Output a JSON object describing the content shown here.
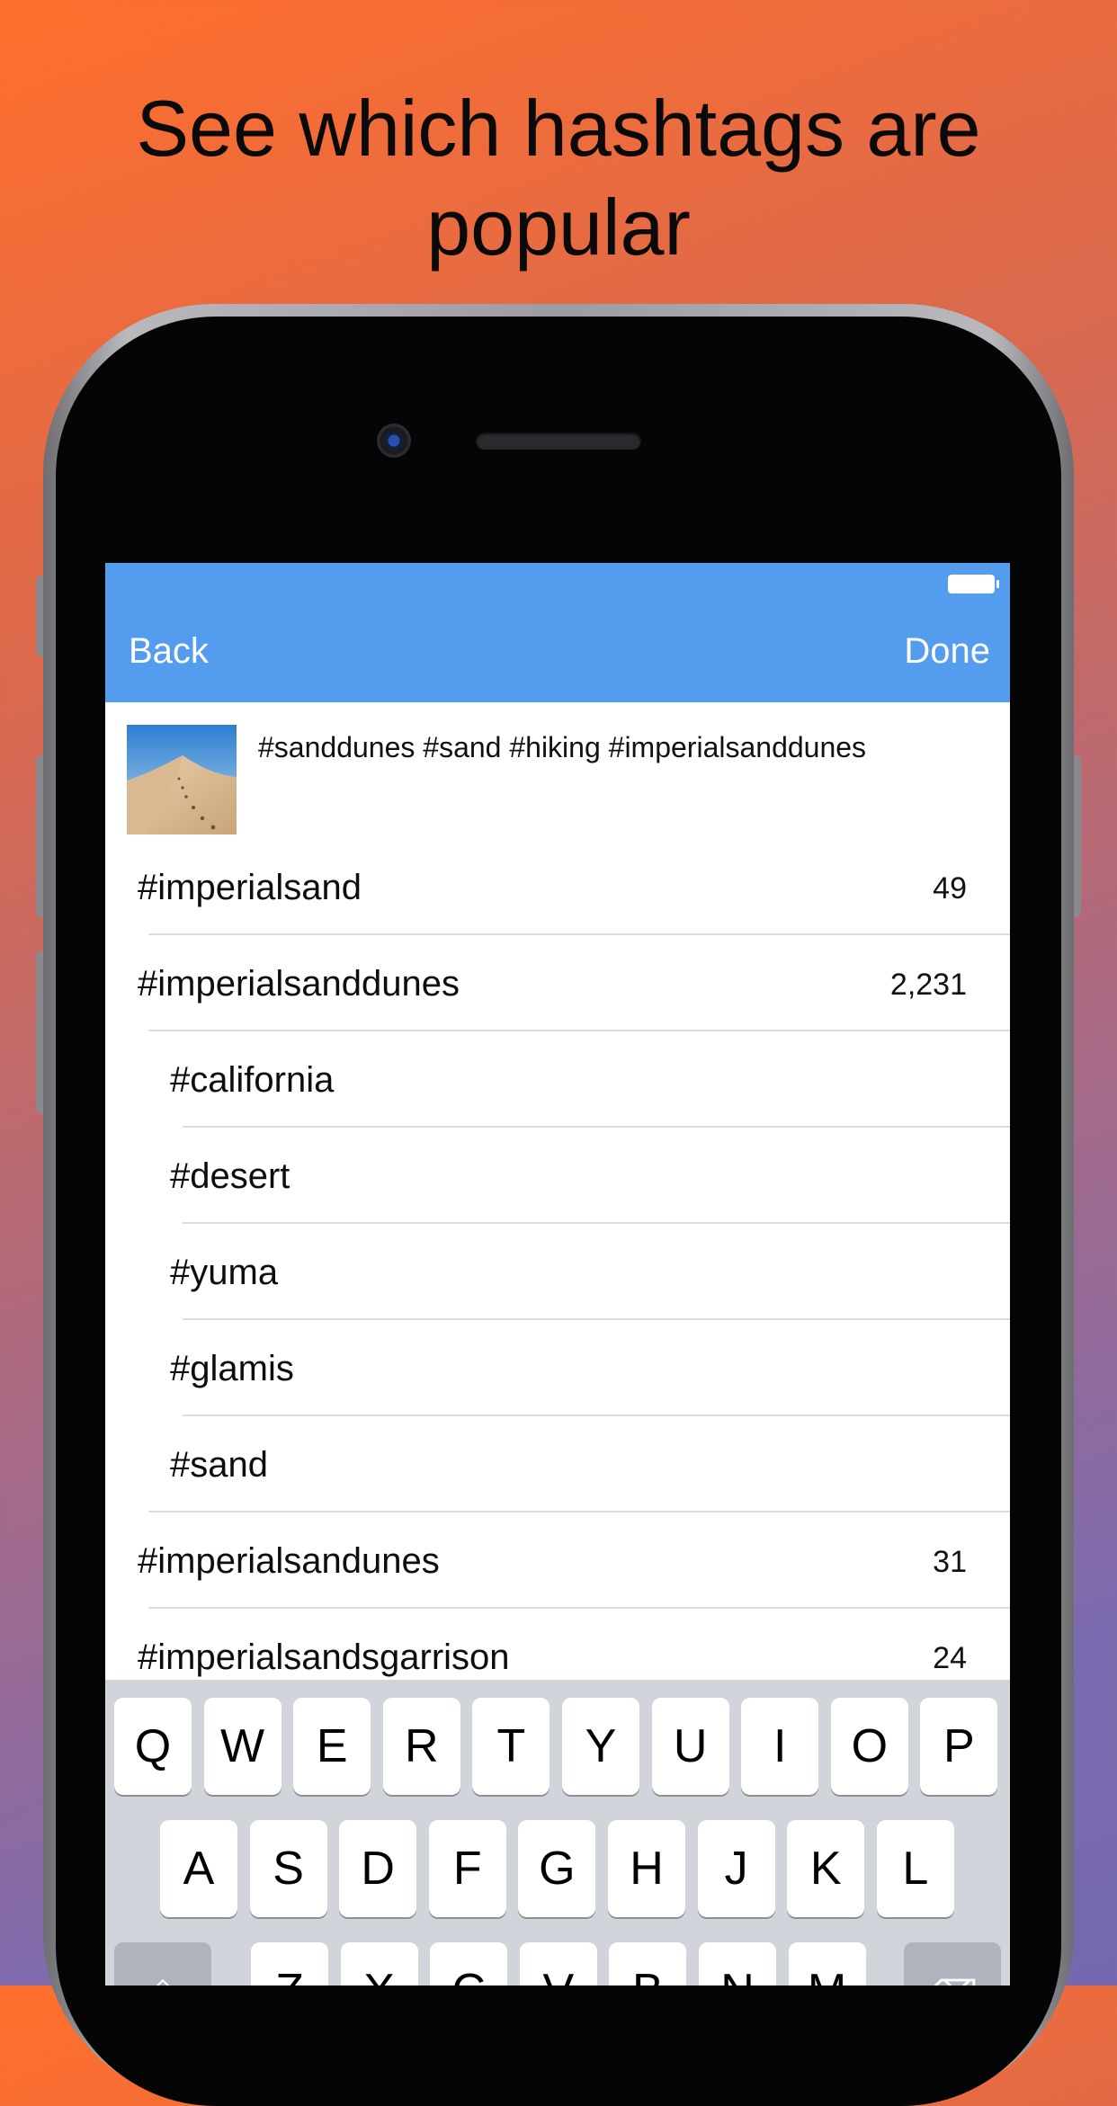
{
  "headline": {
    "line1": "See which hashtags are",
    "line2": "popular"
  },
  "navbar": {
    "back_label": "Back",
    "done_label": "Done",
    "color": "#549cee"
  },
  "post": {
    "caption": "#sanddunes #sand #hiking #imperialsanddunes",
    "thumbnail": "desert-dunes-photo"
  },
  "hashtags": [
    {
      "tag": "#imperialsand",
      "count": "49"
    },
    {
      "tag": "#imperialsanddunes",
      "count": "2,231"
    },
    {
      "tag": "#california",
      "count": ""
    },
    {
      "tag": "#desert",
      "count": ""
    },
    {
      "tag": "#yuma",
      "count": ""
    },
    {
      "tag": "#glamis",
      "count": ""
    },
    {
      "tag": "#sand",
      "count": ""
    },
    {
      "tag": "#imperialsandunes",
      "count": "31"
    },
    {
      "tag": "#imperialsandsgarrison",
      "count": "24"
    }
  ],
  "keyboard": {
    "row1": [
      "Q",
      "W",
      "E",
      "R",
      "T",
      "Y",
      "U",
      "I",
      "O",
      "P"
    ],
    "row2": [
      "A",
      "S",
      "D",
      "F",
      "G",
      "H",
      "J",
      "K",
      "L"
    ],
    "row3": [
      "Z",
      "X",
      "C",
      "V",
      "B",
      "N",
      "M"
    ],
    "shift_icon": "shift-arrow-icon",
    "delete_icon": "backspace-icon"
  }
}
